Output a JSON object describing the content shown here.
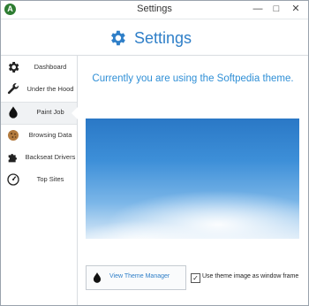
{
  "window": {
    "title": "Settings",
    "app_icon_letter": "A"
  },
  "controls": {
    "minimize": "—",
    "maximize": "□",
    "close": "✕"
  },
  "header": {
    "title": "Settings",
    "icon": "gear-icon"
  },
  "sidebar": {
    "items": [
      {
        "label": "Dashboard",
        "icon": "gear-icon"
      },
      {
        "label": "Under the Hood",
        "icon": "wrench-icon"
      },
      {
        "label": "Paint Job",
        "icon": "paint-drop-icon",
        "active": true
      },
      {
        "label": "Browsing Data",
        "icon": "cookie-icon"
      },
      {
        "label": "Backseat Drivers",
        "icon": "puzzle-piece-icon"
      },
      {
        "label": "Top Sites",
        "icon": "speedometer-icon"
      }
    ]
  },
  "main": {
    "theme_info": "Currently you are using the Softpedia theme.",
    "theme_manager_label": "View Theme Manager",
    "window_frame_label": "Use theme image as window frame",
    "window_frame_checked": true,
    "checkbox_mark": "✓"
  },
  "colors": {
    "accent": "#2f7fc8",
    "link": "#2f8fd6"
  }
}
